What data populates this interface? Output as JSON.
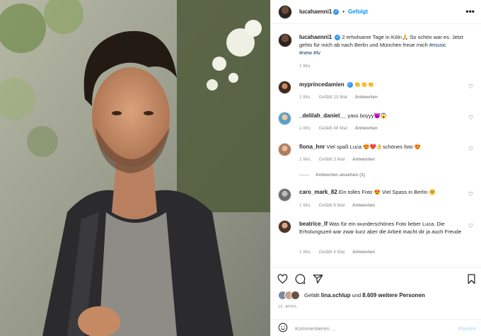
{
  "header": {
    "username": "lucahaenni1",
    "separator": "•",
    "follow_label": "Gefolgt",
    "more_label": "•••"
  },
  "caption": {
    "username": "lucahaenni1",
    "text_1": "2 erholsame Tage in Köln",
    "emoji_1": "🙏",
    "text_2": "So schön war es. Jetzt gehts für mich ab nach Berlin und München freue mich",
    "tag_1": "#music",
    "tag_2": "#new",
    "tag_3": "#tv",
    "time": "1 Wo."
  },
  "comments": [
    {
      "username": "myprincedamien",
      "text": "👏👏👏",
      "time": "1 Wo.",
      "likes": "Gefällt 13 Mal",
      "reply": "Antworten"
    },
    {
      "username": "_delilah_daniel__",
      "text": "yass boyyy😈😱",
      "time": "1 Wo.",
      "likes": "Gefällt 48 Mal",
      "reply": "Antworten"
    },
    {
      "username": "fiona_hnr",
      "text": "Viel spaß Luca 😍❤️👌schönes foto 😍",
      "time": "1 Wo.",
      "likes": "Gefällt 3 Mal",
      "reply": "Antworten",
      "view_replies": "Antworten ansehen (1)"
    },
    {
      "username": "caro_mark_82",
      "text": "Ein tolles Foto 😍 Viel Spass in Berlin 🤗",
      "time": "1 Wo.",
      "likes": "Gefällt 6 Mal",
      "reply": "Antworten"
    },
    {
      "username": "beatrice_lf",
      "text": "Was für ein wunderschönes Foto lieber Luca. Die Erholungszeit war zwar kurz aber die Arbeit macht dir ja auch Freude",
      "time": "1 Wo.",
      "likes": "Gefällt 4 Mal",
      "reply": "Antworten"
    }
  ],
  "likes": {
    "prefix": "Gefällt",
    "user": "lina.schlup",
    "middle": "und",
    "count": "8.609 weitere Personen"
  },
  "date": "10. APRIL",
  "add_comment": {
    "placeholder": "Kommentieren ...",
    "post_label": "Posten"
  },
  "icons": {
    "like": "heart-icon",
    "comment": "comment-icon",
    "share": "share-icon",
    "save": "bookmark-icon",
    "emoji": "emoji-icon"
  },
  "colors": {
    "link": "#00376b",
    "follow": "#0095f6",
    "muted": "#8e8e8e",
    "verified": "#3897f0"
  }
}
